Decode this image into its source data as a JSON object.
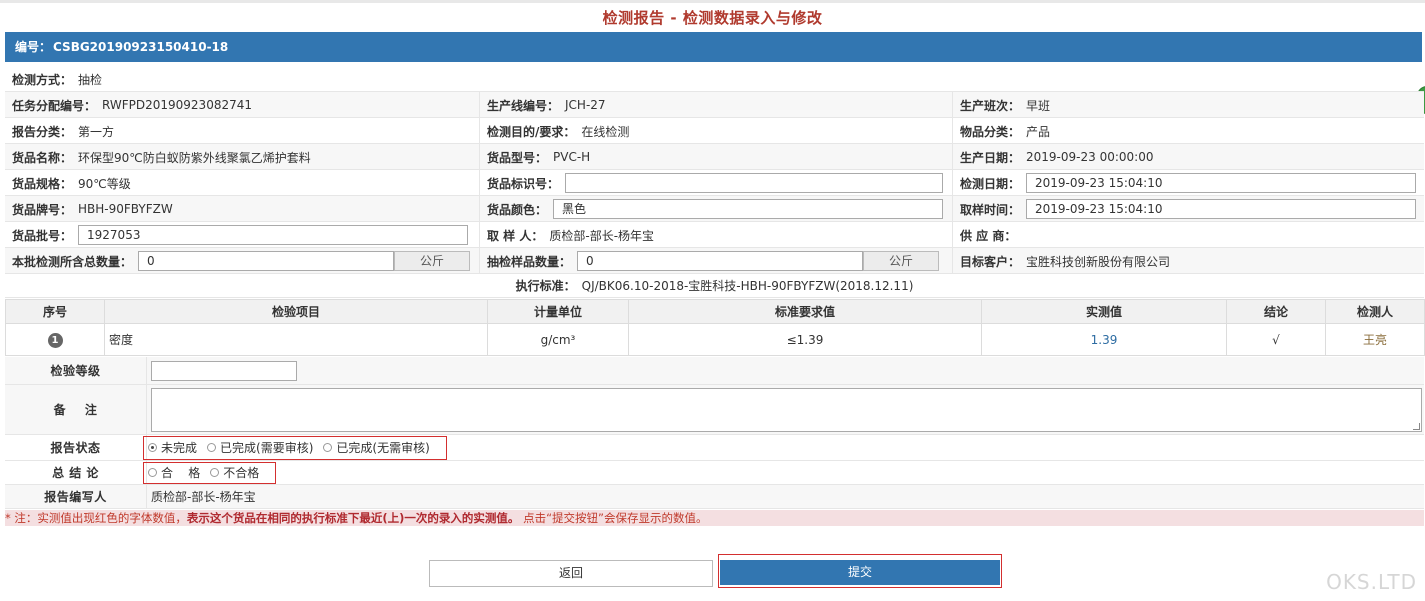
{
  "page_title": "检测报告 - 检测数据录入与修改",
  "header": {
    "label": "编号：",
    "value": "CSBG20190923150410-18"
  },
  "fields": {
    "method": {
      "label": "检测方式：",
      "value": "抽检"
    },
    "task_no": {
      "label": "任务分配编号：",
      "value": "RWFPD20190923082741"
    },
    "line_no": {
      "label": "生产线编号：",
      "value": "JCH-27"
    },
    "shift": {
      "label": "生产班次：",
      "value": "早班"
    },
    "report_category": {
      "label": "报告分类：",
      "value": "第一方"
    },
    "purpose": {
      "label": "检测目的/要求：",
      "value": "在线检测"
    },
    "item_category": {
      "label": "物品分类：",
      "value": "产品"
    },
    "goods_name": {
      "label": "货品名称：",
      "value": "环保型90℃防白蚁防紫外线聚氯乙烯护套料"
    },
    "goods_model": {
      "label": "货品型号：",
      "value": "PVC-H"
    },
    "prod_date": {
      "label": "生产日期：",
      "value": "2019-09-23 00:00:00"
    },
    "goods_spec": {
      "label": "货品规格：",
      "value": "90℃等级"
    },
    "goods_mark": {
      "label": "货品标识号：",
      "value": ""
    },
    "test_date": {
      "label": "检测日期：",
      "value": "2019-09-23 15:04:10"
    },
    "goods_brand": {
      "label": "货品牌号：",
      "value": "HBH-90FBYFZW"
    },
    "goods_color": {
      "label": "货品颜色：",
      "value": "黑色"
    },
    "sample_time": {
      "label": "取样时间：",
      "value": "2019-09-23 15:04:10"
    },
    "batch_no": {
      "label": "货品批号：",
      "value": "1927053"
    },
    "sampler": {
      "label": "取 样 人：",
      "value": "质检部-部长-杨年宝"
    },
    "supplier": {
      "label": "供 应 商：",
      "value": ""
    },
    "batch_total": {
      "label": "本批检测所含总数量：",
      "value": "0",
      "unit": "公斤"
    },
    "sample_qty": {
      "label": "抽检样品数量：",
      "value": "0",
      "unit": "公斤"
    },
    "target_customer": {
      "label": "目标客户：",
      "value": "宝胜科技创新股份有限公司"
    }
  },
  "standard": {
    "label": "执行标准：",
    "value": "QJ/BK06.10-2018-宝胜科技-HBH-90FBYFZW(2018.12.11)"
  },
  "table": {
    "headers": [
      "序号",
      "检验项目",
      "计量单位",
      "标准要求值",
      "实测值",
      "结论",
      "检测人"
    ],
    "rows": [
      {
        "index": "1",
        "item": "密度",
        "unit": "g/cm³",
        "requirement": "≤1.39",
        "measured": "1.39",
        "conclusion": "√",
        "tester": "王亮"
      }
    ]
  },
  "lower": {
    "grade_label": "检验等级",
    "remark_label": "备    注",
    "status_label": "报告状态",
    "status_options": [
      "未完成",
      "已完成(需要审核)",
      "已完成(无需审核)"
    ],
    "conclusion_label": "总 结 论",
    "conclusion_options": [
      "合    格",
      "不合格"
    ],
    "author_label": "报告编写人",
    "author_value": "质检部-部长-杨年宝"
  },
  "note": {
    "prefix": "* 注：实测值出现红色的字体数值，",
    "bold": "表示这个货品在相同的执行标准下最近(上)一次的录入的实测值。",
    "suffix": " 点击“提交按钮”会保存显示的数值。"
  },
  "buttons": {
    "back": "返回",
    "submit": "提交"
  },
  "watermark": "OKS.LTD",
  "colors": {
    "accent": "#3276b1",
    "title": "#b03a2e",
    "highlight_border": "#d32f2f"
  }
}
